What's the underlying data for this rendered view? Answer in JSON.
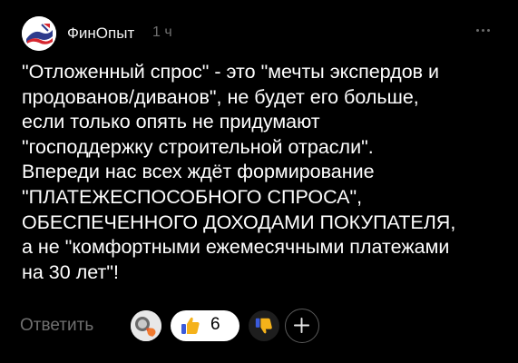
{
  "comment": {
    "author": "ФинОпыт",
    "time": "1 ч",
    "text": "\"Отложенный спрос\" - это \"мечты экспердов и\nпродованов/диванов\", не будет его больше,\nесли только опять не придумают\n\"господдержку строительной отрасли\".\nВпереди нас всех ждёт формирование\n\"ПЛАТЕЖЕСПОСОБНОГО СПРОСА\",\nОБЕСПЕЧЕННОГО ДОХОДАМИ ПОКУПАТЕЛЯ,\nа не \"комфортными ежемесячными платежами\nна 30 лет\"!"
  },
  "actions": {
    "reply_label": "Ответить",
    "reaction_count": "6"
  },
  "icons": {
    "more": "more-dots-icon",
    "like": "thumbs-up-icon",
    "dislike": "thumbs-down-icon",
    "add": "plus-icon"
  },
  "colors": {
    "background": "#000000",
    "text": "#ffffff",
    "muted": "#707070",
    "badge": "#ffffff",
    "thumb": "#f5b21a",
    "dislike_button": "#1e1e1e"
  }
}
